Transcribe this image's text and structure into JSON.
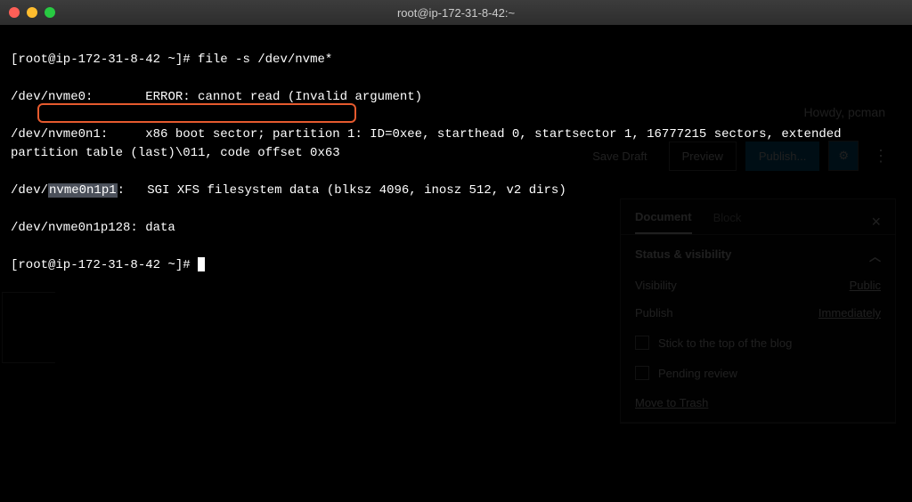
{
  "window": {
    "title": "root@ip-172-31-8-42:~"
  },
  "terminal": {
    "prompt1": "[root@ip-172-31-8-42 ~]# ",
    "command1": "file -s /dev/nvme*",
    "line1_dev": "/dev/nvme0:       ",
    "line1_rest": "ERROR: cannot read (Invalid argument)",
    "line2": "/dev/nvme0n1:     x86 boot sector; partition 1: ID=0xee, starthead 0, startsector 1, 16777215 sectors, extended partition table (last)\\011, code offset 0x63",
    "line3_prefix": "/dev/",
    "line3_highlight": "nvme0n1p1",
    "line3_mid": ":   ",
    "line3_rest": "SGI XFS filesystem data (blksz 4096, inosz 512, v2 dirs)",
    "line4": "/dev/nvme0n1p128: data",
    "prompt2": "[root@ip-172-31-8-42 ~]# "
  },
  "bg": {
    "howdy": "Howdy, pcman",
    "save_draft": "Save Draft",
    "preview": "Preview",
    "publish": "Publish...",
    "tab_document": "Document",
    "tab_block": "Block",
    "status_header": "Status & visibility",
    "visibility_label": "Visibility",
    "visibility_value": "Public",
    "publish_label": "Publish",
    "publish_value": "Immediately",
    "stick_top": "Stick to the top of the blog",
    "pending_review": "Pending review",
    "move_trash": "Move to Trash"
  }
}
